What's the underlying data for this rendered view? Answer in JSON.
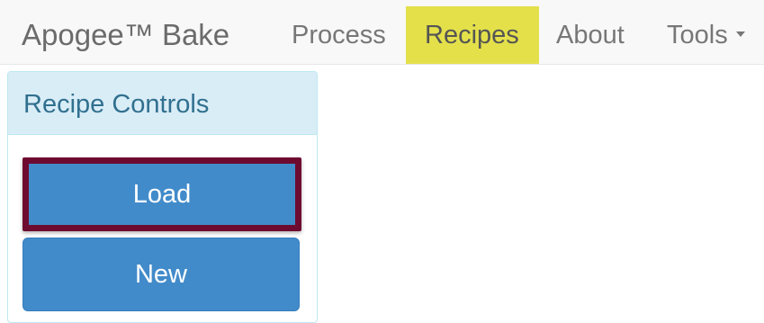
{
  "navbar": {
    "brand": "Apogee™ Bake",
    "items": [
      {
        "label": "Process"
      },
      {
        "label": "Recipes",
        "active": true
      },
      {
        "label": "About"
      },
      {
        "label": "Tools"
      }
    ],
    "active_color": "#e4e04a"
  },
  "panel": {
    "title": "Recipe Controls",
    "buttons": {
      "load_label": "Load",
      "new_label": "New"
    },
    "highlight_color": "#6e0a30"
  }
}
